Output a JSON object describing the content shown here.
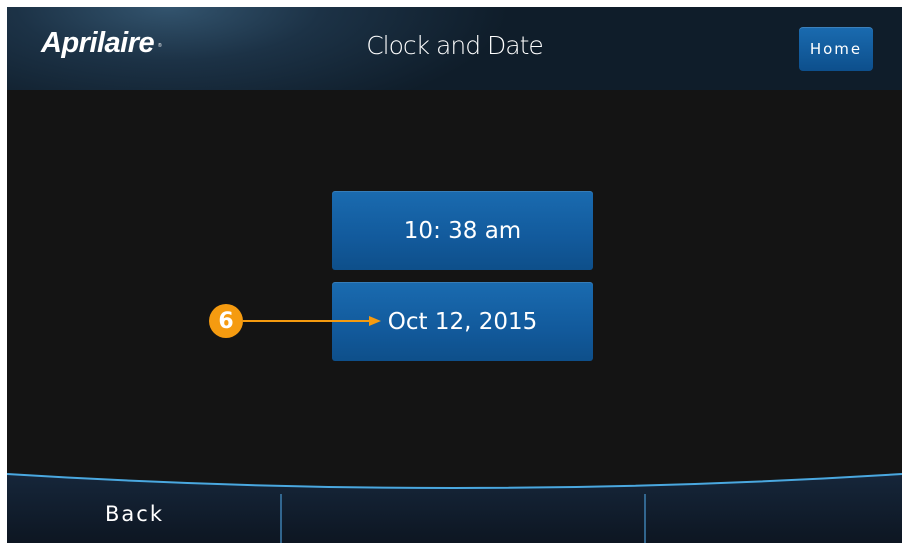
{
  "header": {
    "brand": "Aprilaire",
    "brand_mark": "®",
    "title": "Clock and Date",
    "home_label": "Home"
  },
  "settings": {
    "time_value": "10: 38 am",
    "date_value": "Oct 12, 2015"
  },
  "callout": {
    "number": "6",
    "color": "#f59b10"
  },
  "footer": {
    "back_label": "Back"
  },
  "colors": {
    "button_blue": "#1a6bb0",
    "background": "#141414",
    "accent_line": "#4aa8e0"
  }
}
